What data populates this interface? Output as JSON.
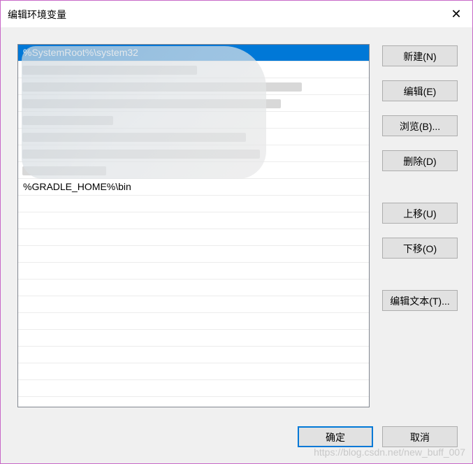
{
  "window": {
    "title": "编辑环境变量",
    "close_glyph": "✕"
  },
  "list": {
    "rows": [
      {
        "text": "%SystemRoot%\\system32",
        "state": "selected"
      },
      {
        "text": "",
        "state": "blurred"
      },
      {
        "text": "",
        "state": "blurred"
      },
      {
        "text": "",
        "state": "blurred"
      },
      {
        "text": "",
        "state": "blurred"
      },
      {
        "text": "",
        "state": "blurred"
      },
      {
        "text": "",
        "state": "blurred"
      },
      {
        "text": "",
        "state": "blurred"
      },
      {
        "text": "%GRADLE_HOME%\\bin",
        "state": "normal"
      },
      {
        "text": "",
        "state": "empty"
      },
      {
        "text": "",
        "state": "empty"
      },
      {
        "text": "",
        "state": "empty"
      },
      {
        "text": "",
        "state": "empty"
      },
      {
        "text": "",
        "state": "empty"
      },
      {
        "text": "",
        "state": "empty"
      },
      {
        "text": "",
        "state": "empty"
      },
      {
        "text": "",
        "state": "empty"
      },
      {
        "text": "",
        "state": "empty"
      },
      {
        "text": "",
        "state": "empty"
      },
      {
        "text": "",
        "state": "empty"
      },
      {
        "text": "",
        "state": "empty"
      },
      {
        "text": "",
        "state": "empty"
      }
    ]
  },
  "buttons": {
    "new": "新建(N)",
    "edit": "编辑(E)",
    "browse": "浏览(B)...",
    "delete": "删除(D)",
    "move_up": "上移(U)",
    "move_down": "下移(O)",
    "edit_text": "编辑文本(T)...",
    "ok": "确定",
    "cancel": "取消"
  },
  "watermark": "https://blog.csdn.net/new_buff_007",
  "colors": {
    "selection": "#0078d7",
    "window_border": "#c868c8"
  }
}
